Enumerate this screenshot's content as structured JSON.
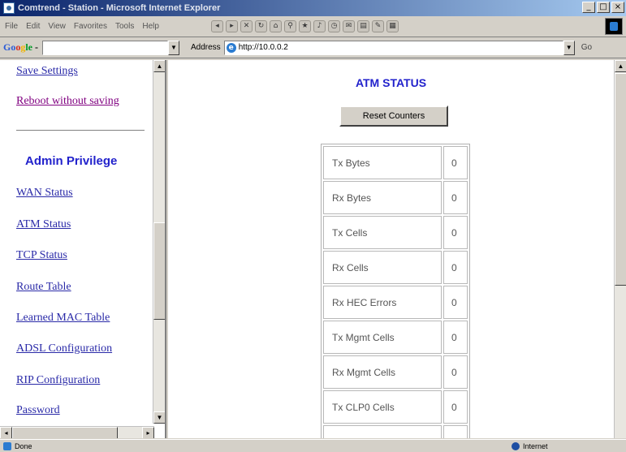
{
  "window": {
    "title": "Comtrend - Station - Microsoft Internet Explorer",
    "btn_minimize": "_",
    "btn_maximize": "□",
    "btn_close": "×"
  },
  "menu": [
    "File",
    "Edit",
    "View",
    "Favorites",
    "Tools",
    "Help"
  ],
  "toolbar_icons": [
    "back-icon",
    "forward-icon",
    "stop-icon",
    "refresh-icon",
    "home-icon",
    "search-icon",
    "favorites-icon",
    "media-icon",
    "history-icon",
    "mail-icon",
    "print-icon",
    "edit-icon",
    "discuss-icon"
  ],
  "google": {
    "g1": "Go",
    "g2": "o",
    "g3": "g",
    "g4": "le",
    "suffix": " -"
  },
  "address": {
    "label": "Address",
    "url": "http://10.0.0.2",
    "go": "Go"
  },
  "sidebar": {
    "top_links": [
      {
        "label": "Save Settings"
      },
      {
        "label": "Reboot without saving"
      }
    ],
    "section_title": "Admin Privilege",
    "links": [
      {
        "label": "WAN Status"
      },
      {
        "label": "ATM Status"
      },
      {
        "label": "TCP Status"
      },
      {
        "label": "Route Table"
      },
      {
        "label": "Learned MAC Table"
      },
      {
        "label": "ADSL Configuration"
      },
      {
        "label": "RIP Configuration"
      },
      {
        "label": "Password"
      }
    ]
  },
  "main": {
    "heading": "ATM STATUS",
    "reset_button": "Reset Counters",
    "stats": [
      {
        "label": "Tx Bytes",
        "value": "0"
      },
      {
        "label": "Rx Bytes",
        "value": "0"
      },
      {
        "label": "Tx Cells",
        "value": "0"
      },
      {
        "label": "Rx Cells",
        "value": "0"
      },
      {
        "label": "Rx HEC Errors",
        "value": "0"
      },
      {
        "label": "Tx Mgmt Cells",
        "value": "0"
      },
      {
        "label": "Rx Mgmt Cells",
        "value": "0"
      },
      {
        "label": "Tx CLP0 Cells",
        "value": "0"
      }
    ]
  },
  "status": {
    "text": "Done",
    "zone": "Internet"
  }
}
